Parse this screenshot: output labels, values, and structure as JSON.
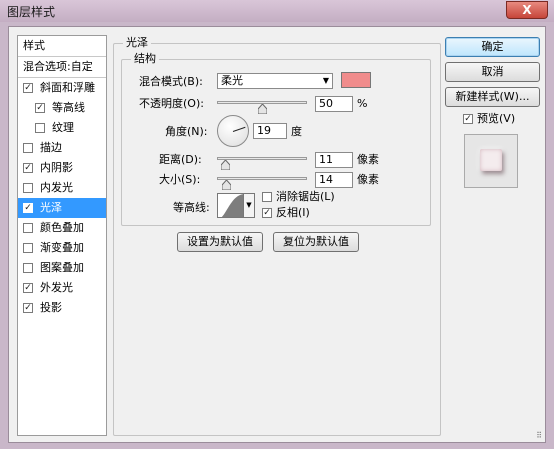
{
  "window": {
    "title": "图层样式",
    "close_label": "X"
  },
  "style_list": {
    "header": "样式",
    "blend_options": "混合选项:自定",
    "items": [
      {
        "label": "斜面和浮雕",
        "checked": true,
        "indent": false,
        "selected": false
      },
      {
        "label": "等高线",
        "checked": true,
        "indent": true,
        "selected": false
      },
      {
        "label": "纹理",
        "checked": false,
        "indent": true,
        "selected": false
      },
      {
        "label": "描边",
        "checked": false,
        "indent": false,
        "selected": false
      },
      {
        "label": "内阴影",
        "checked": true,
        "indent": false,
        "selected": false
      },
      {
        "label": "内发光",
        "checked": false,
        "indent": false,
        "selected": false
      },
      {
        "label": "光泽",
        "checked": true,
        "indent": false,
        "selected": true
      },
      {
        "label": "颜色叠加",
        "checked": false,
        "indent": false,
        "selected": false
      },
      {
        "label": "渐变叠加",
        "checked": false,
        "indent": false,
        "selected": false
      },
      {
        "label": "图案叠加",
        "checked": false,
        "indent": false,
        "selected": false
      },
      {
        "label": "外发光",
        "checked": true,
        "indent": false,
        "selected": false
      },
      {
        "label": "投影",
        "checked": true,
        "indent": false,
        "selected": false
      }
    ]
  },
  "satin": {
    "group_title": "光泽",
    "structure_title": "结构",
    "blend_mode_label": "混合模式(B):",
    "blend_mode_value": "柔光",
    "color": "#f08c8c",
    "opacity_label": "不透明度(O):",
    "opacity_value": "50",
    "opacity_unit": "%",
    "opacity_fraction": 0.5,
    "angle_label": "角度(N):",
    "angle_value": "19",
    "angle_unit": "度",
    "distance_label": "距离(D):",
    "distance_value": "11",
    "distance_unit": "像素",
    "distance_fraction": 0.044,
    "size_label": "大小(S):",
    "size_value": "14",
    "size_unit": "像素",
    "size_fraction": 0.056,
    "contour_label": "等高线:",
    "antialias_label": "消除锯齿(L)",
    "antialias_checked": false,
    "invert_label": "反相(I)",
    "invert_checked": true,
    "set_default_label": "设置为默认值",
    "reset_default_label": "复位为默认值"
  },
  "buttons": {
    "ok": "确定",
    "cancel": "取消",
    "new_style": "新建样式(W)...",
    "preview_label": "预览(V)",
    "preview_checked": true
  },
  "icons": {
    "check": "check-icon",
    "dropdown": "chevron-down-icon",
    "resize": "resize-grip-icon"
  }
}
